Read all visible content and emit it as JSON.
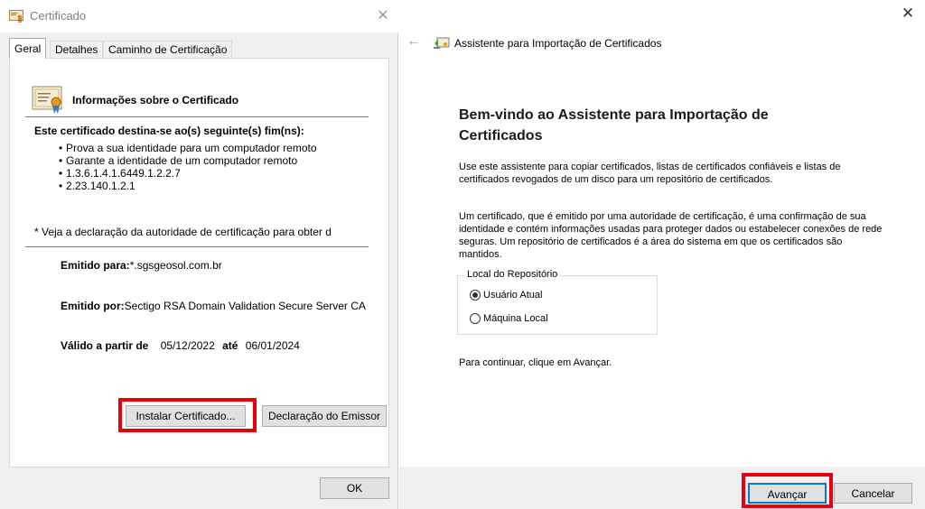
{
  "certificate_dialog": {
    "title": "Certificado",
    "close_glyph": "✕",
    "tabs": [
      "Geral",
      "Detalhes",
      "Caminho de Certificação"
    ],
    "info_title": "Informações sobre o Certificado",
    "purpose_title": "Este certificado destina-se ao(s) seguinte(s) fim(ns):",
    "purposes": [
      "Prova a sua identidade para um computador remoto",
      "Garante a identidade de um computador remoto",
      "1.3.6.1.4.1.6449.1.2.2.7",
      "2.23.140.1.2.1"
    ],
    "bullet": "•",
    "note": "* Veja a declaração da autoridade de certificação para obter d",
    "issued_to_label": "Emitido para:",
    "issued_to_value": "*.sgsgeosol.com.br",
    "issued_by_label": "Emitido por:",
    "issued_by_value": "Sectigo RSA Domain Validation Secure Server CA",
    "valid_from_label": "Válido a partir de",
    "valid_from_value": "05/12/2022",
    "valid_to_label": "até",
    "valid_to_value": "06/01/2024",
    "install_button": "Instalar Certificado...",
    "issuer_statement_button": "Declaração do Emissor",
    "ok_button": "OK",
    "icons": {
      "title": "certificate-icon",
      "info": "certificate-ribbon-icon"
    },
    "highlight_color": "#e8000b"
  },
  "import_wizard": {
    "close_glyph": "✕",
    "back_glyph": "←",
    "title": "Assistente para Importação de Certificados",
    "heading": "Bem-vindo ao Assistente para Importação de Certificados",
    "paragraph1": "Use este assistente para copiar certificados, listas de certificados confiáveis e listas de certificados revogados de um disco para um repositório de certificados.",
    "paragraph2": "Um certificado, que é emitido por uma autoridade de certificação, é uma confirmação de sua identidade e contém informações usadas para proteger dados ou estabelecer conexões de rede seguras. Um repositório de certificados é a área do sistema em que os certificados são mantidos.",
    "store_location_label": "Local do Repositório",
    "options": [
      {
        "label": "Usuário Atual",
        "selected": true
      },
      {
        "label": "Máquina Local",
        "selected": false
      }
    ],
    "continue_text": "Para continuar, clique em Avançar.",
    "next_button": "Avançar",
    "cancel_button": "Cancelar",
    "icons": {
      "wizard": "certificate-wizard-icon",
      "back": "back-arrow-icon"
    },
    "highlight_color": "#e8000b"
  }
}
